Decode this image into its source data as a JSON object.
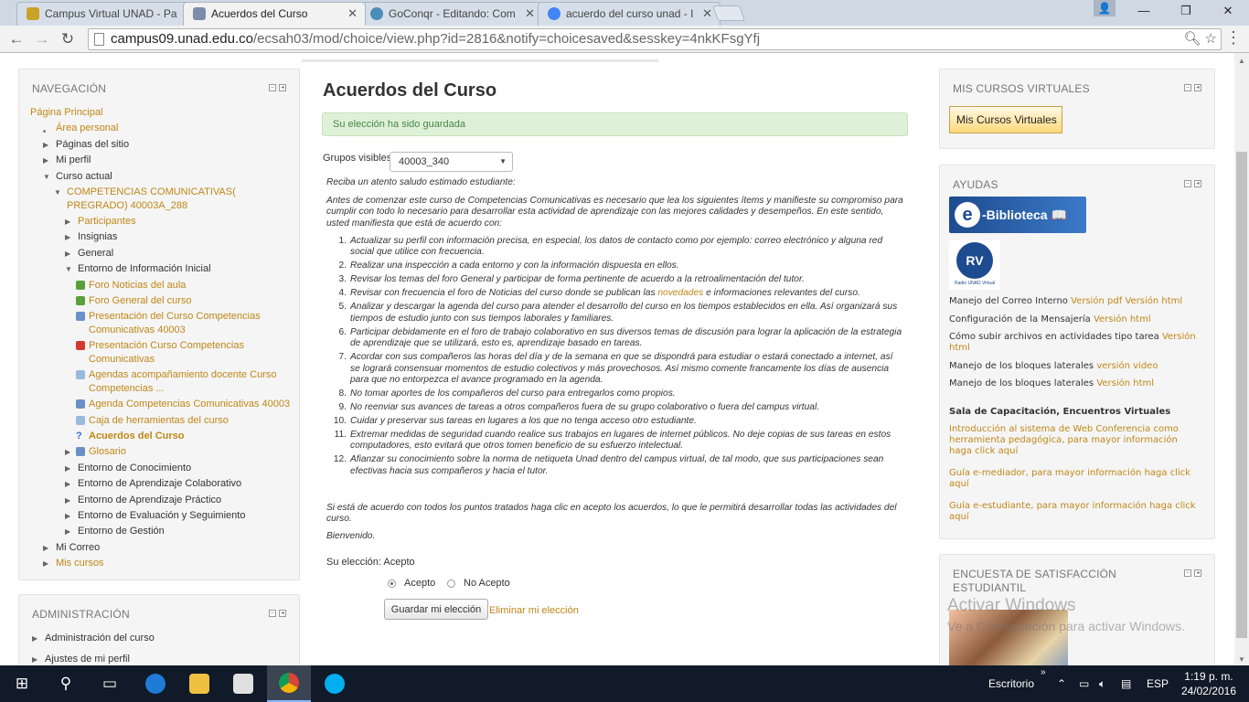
{
  "browser": {
    "tabs": [
      {
        "title": "Campus Virtual UNAD - Pa",
        "color": "#c9a227",
        "active": false
      },
      {
        "title": "Acuerdos del Curso",
        "color": "#7a8ea8",
        "active": true
      },
      {
        "title": "GoConqr - Editando: Com",
        "color": "#4a8db8",
        "active": false
      },
      {
        "title": "acuerdo del curso unad - I",
        "color": "#4285f4",
        "active": false
      }
    ],
    "url_host": "campus09.unad.edu.co",
    "url_path": "/ecsah03/mod/choice/view.php?id=2816&notify=choicesaved&sesskey=4nkKFsgYfj"
  },
  "navigation": {
    "title": "NAVEGACIÓN",
    "items": [
      {
        "label": "Página Principal",
        "level": 0,
        "type": "link"
      },
      {
        "label": "Área personal",
        "level": 1,
        "type": "link-bullet"
      },
      {
        "label": "Páginas del sitio",
        "level": 1,
        "type": "closed"
      },
      {
        "label": "Mi perfil",
        "level": 1,
        "type": "closed"
      },
      {
        "label": "Curso actual",
        "level": 1,
        "type": "open"
      },
      {
        "label": "COMPETENCIAS COMUNICATIVAS( PREGRADO) 40003A_288",
        "level": 2,
        "type": "open-link-multi"
      },
      {
        "label": "Participantes",
        "level": 3,
        "type": "closed-link"
      },
      {
        "label": "Insignias",
        "level": 3,
        "type": "closed"
      },
      {
        "label": "General",
        "level": 3,
        "type": "closed"
      },
      {
        "label": "Entorno de Información Inicial",
        "level": 3,
        "type": "open"
      },
      {
        "label": "Foro Noticias del aula",
        "level": 4,
        "type": "res",
        "icon": "#5c9f3a"
      },
      {
        "label": "Foro General del curso",
        "level": 4,
        "type": "res",
        "icon": "#5c9f3a"
      },
      {
        "label": "Presentación del Curso Competencias Comunicativas 40003",
        "level": 4,
        "type": "res-multi",
        "icon": "#6b8fc9"
      },
      {
        "label": "Presentación Curso Competencias Comunicativas",
        "level": 4,
        "type": "res-multi",
        "icon": "#d23a2e"
      },
      {
        "label": "Agendas acompañamiento docente Curso Competencias ...",
        "level": 4,
        "type": "res-multi",
        "icon": "#9bb8dd"
      },
      {
        "label": "Agenda Competencias Comunicativas 40003",
        "level": 4,
        "type": "res",
        "icon": "#6b8fc9"
      },
      {
        "label": "Caja de herramientas del curso",
        "level": 4,
        "type": "res",
        "icon": "#9bb8dd"
      },
      {
        "label": "Acuerdos del Curso",
        "level": 4,
        "type": "res-current",
        "icon": "#3a6fc4"
      },
      {
        "label": "Glosario",
        "level": 4,
        "type": "res-closed",
        "icon": "#6b8fc9"
      },
      {
        "label": "Entorno de Conocimiento",
        "level": 3,
        "type": "closed"
      },
      {
        "label": "Entorno de Aprendizaje Colaborativo",
        "level": 3,
        "type": "closed"
      },
      {
        "label": "Entorno de Aprendizaje Práctico",
        "level": 3,
        "type": "closed"
      },
      {
        "label": "Entorno de Evaluación y Seguimiento",
        "level": 3,
        "type": "closed"
      },
      {
        "label": "Entorno de Gestión",
        "level": 3,
        "type": "closed"
      },
      {
        "label": "Mi Correo",
        "level": 1,
        "type": "closed"
      },
      {
        "label": "Mis cursos",
        "level": 1,
        "type": "closed-link"
      }
    ]
  },
  "administration": {
    "title": "ADMINISTRACIÓN",
    "items": [
      "Administración del curso",
      "Ajustes de mi perfil"
    ]
  },
  "main": {
    "title": "Acuerdos del Curso",
    "alert": "Su elección ha sido guardada",
    "group_label": "Grupos visibles",
    "group_value": "40003_340",
    "greeting": "Reciba un atento saludo estimado estudiante:",
    "intro": "Antes de comenzar este curso de Competencias Comunicativas es necesario que lea los siguientes ítems y manifieste su compromiso para cumplir con todo lo necesario para desarrollar esta actividad de aprendizaje con las mejores calidades y desempeños. En este sentido, usted manifiesta que está de acuerdo con:",
    "rules": [
      "Actualizar su perfil con información precisa, en especial, los datos de contacto como por ejemplo: correo electrónico y alguna red social que utilice con frecuencia.",
      "Realizar una inspección a cada entorno y con la información dispuesta en ellos.",
      "Revisar los temas del foro General y participar de forma pertinente de acuerdo a la retroalimentación del tutor.",
      "Revisar con frecuencia el foro de Noticias del curso donde se publican las novedades e informaciones relevantes del curso.",
      "Analizar y descargar la agenda del curso para atender el desarrollo del curso en los tiempos establecidos en ella. Así organizará sus tiempos de estudio junto con sus tiempos laborales y familiares.",
      "Participar debidamente en el foro de trabajo colaborativo en sus diversos temas de discusión para lograr la aplicación de la estrategia de aprendizaje que se utilizará, esto es, aprendizaje basado en tareas.",
      "Acordar con sus compañeros las horas del día y de la semana en que se dispondrá para estudiar o estará conectado a internet, así se logrará consensuar momentos de estudio colectivos y más provechosos. Así mismo comente francamente los días de ausencia para que no entorpezca el avance programado en la agenda.",
      "No tomar aportes de los compañeros del curso para entregarlos como propios.",
      "No reenviar sus avances de tareas a otros compañeros fuera de su grupo colaborativo o fuera del campus virtual.",
      "Cuidar y preservar sus tareas en lugares a los que no tenga acceso otro estudiante.",
      "Extremar medidas de seguridad cuando realice sus trabajos en lugares de internet públicos. No deje copias de sus tareas en estos computadores, esto evitará que otros tomen beneficio de su esfuerzo intelectual.",
      "Afianzar su conocimiento sobre la norma de netiqueta Unad dentro del campus virtual, de tal modo, que sus participaciones sean efectivas hacia sus compañeros y hacia el tutor."
    ],
    "closing": "Si está de acuerdo con todos los puntos tratados haga clic en acepto los acuerdos, lo que le permitirá desarrollar todas las actividades del curso.",
    "welcome": "Bienvenido.",
    "choice_label": "Su elección: Acepto",
    "options": [
      "Acepto",
      "No Acepto"
    ],
    "selected_option": "Acepto",
    "save_button": "Guardar mi elección",
    "remove_link": "Eliminar mi elección"
  },
  "right": {
    "mis_cursos_title": "MIS CURSOS VIRTUALES",
    "mis_cursos_button": "Mis Cursos Virtuales",
    "ayudas_title": "AYUDAS",
    "ebiblioteca_label": "Biblioteca",
    "radio_label": "Radio UNAD Virtual",
    "help_lines": [
      {
        "text": "Manejo del Correo Interno",
        "links": [
          "Versión pdf",
          "Versión html"
        ]
      },
      {
        "text": "Configuración de la Mensajería",
        "links": [
          "Versión html"
        ]
      },
      {
        "text": "Cómo subir archivos en actividades tipo tarea",
        "links": [
          "Versión html"
        ]
      },
      {
        "text": "Manejo de los bloques laterales",
        "links": [
          "versión video"
        ]
      },
      {
        "text": "Manejo de los bloques laterales",
        "links": [
          "Versión html"
        ]
      }
    ],
    "capacitacion_title": "Sala de Capacitación, Encuentros Virtuales",
    "capacitacion_links": [
      "Introducción al sistema de Web Conferencia como herramienta pedagógica, para mayor información haga click aquí",
      "Guía e-mediador, para mayor información haga click aquí",
      "Guía e-estudiante, para mayor información haga click aquí"
    ],
    "encuesta_title": "ENCUESTA DE SATISFACCIÓN ESTUDIANTIL"
  },
  "watermark": {
    "line1": "Activar Windows",
    "line2": "Ve a Configuración para activar Windows."
  },
  "taskbar": {
    "desktop_label": "Escritorio",
    "lang": "ESP",
    "time": "1:19 p. m.",
    "date": "24/02/2016"
  }
}
